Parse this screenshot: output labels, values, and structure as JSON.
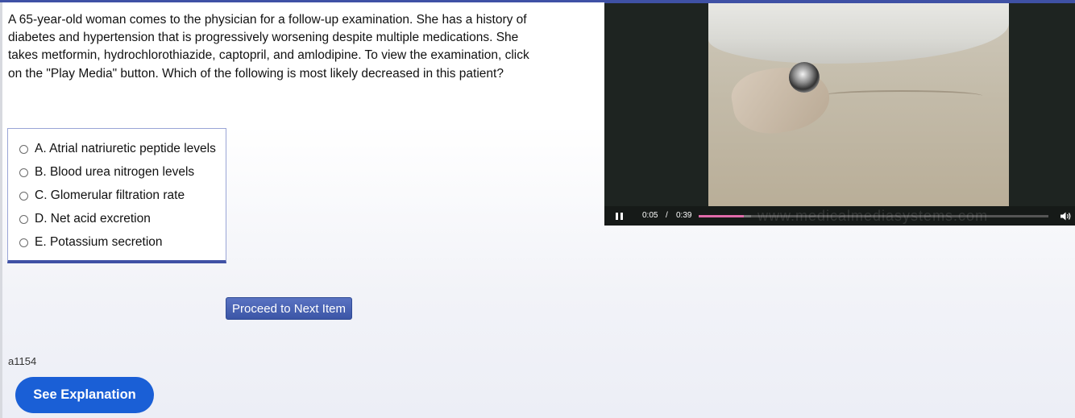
{
  "question": {
    "text": "A 65-year-old woman comes to the physician for a follow-up examination. She has a history of diabetes and hypertension that is progressively worsening despite multiple medications. She takes metformin, hydrochlorothiazide, captopril, and amlodipine. To view the examination, click on the \"Play Media\" button. Which of the following is most likely decreased in this patient?"
  },
  "answers": [
    {
      "label": "A. Atrial natriuretic peptide levels"
    },
    {
      "label": "B. Blood urea nitrogen levels"
    },
    {
      "label": "C. Glomerular filtration rate"
    },
    {
      "label": "D. Net acid excretion"
    },
    {
      "label": "E. Potassium secretion"
    }
  ],
  "buttons": {
    "proceed": "Proceed to Next Item",
    "see_explanation": "See Explanation"
  },
  "item_id": "a1154",
  "video": {
    "current_time": "0:05",
    "separator": "/",
    "duration": "0:39",
    "progress_fraction": 0.128,
    "buffered_fraction": 0.15,
    "watermark": "www.medicalmediasystems.com"
  },
  "colors": {
    "accent": "#3f51a5",
    "proceed_button": "#4a63b4",
    "explanation_button": "#1a5fd6",
    "progress_fill": "#e06aa9"
  },
  "icons": [
    "pause-icon",
    "volume-icon",
    "radio-icon"
  ]
}
